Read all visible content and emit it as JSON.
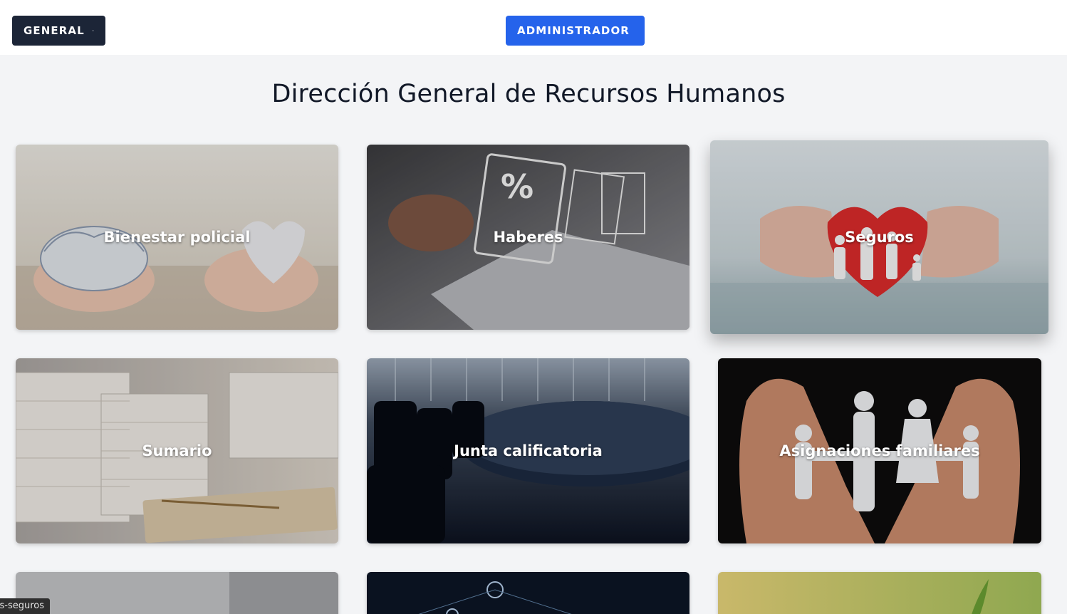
{
  "nav": {
    "general_label": "GENERAL",
    "admin_label": "ADMINISTRADOR"
  },
  "page": {
    "title": "Dirección General de Recursos Humanos"
  },
  "cards": [
    {
      "label": "Bienestar policial"
    },
    {
      "label": "Haberes"
    },
    {
      "label": "Seguros"
    },
    {
      "label": "Sumario"
    },
    {
      "label": "Junta calificatoria"
    },
    {
      "label": "Asignaciones familiares"
    }
  ],
  "status_tooltip": "s-seguros",
  "colors": {
    "general_button": "#1c2537",
    "admin_button": "#2563eb",
    "page_background": "#f3f4f6"
  },
  "icons": [
    "chevron-down-icon"
  ]
}
